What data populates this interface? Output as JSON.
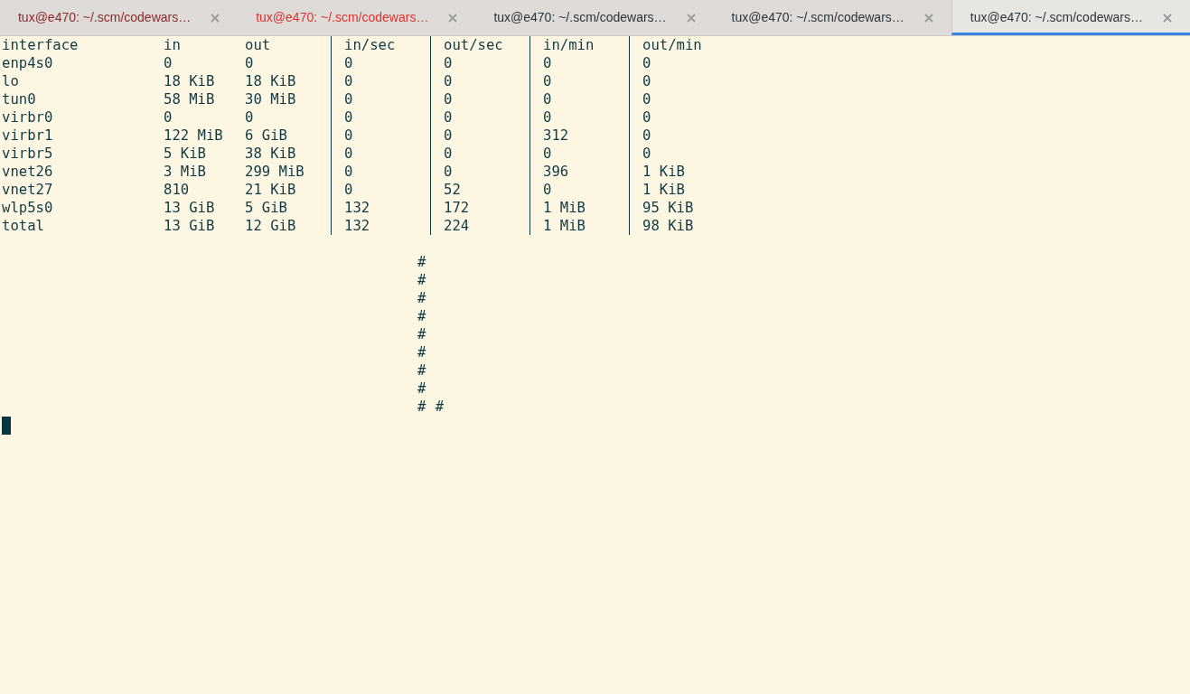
{
  "tabs": [
    {
      "title": "tux@e470: ~/.scm/codewars…",
      "color": "#8b2a2a",
      "selected": false
    },
    {
      "title": "tux@e470: ~/.scm/codewars…",
      "color": "#e0312e",
      "selected": false
    },
    {
      "title": "tux@e470: ~/.scm/codewars…",
      "color": "#2e3436",
      "selected": false
    },
    {
      "title": "tux@e470: ~/.scm/codewars…",
      "color": "#2e3436",
      "selected": false
    },
    {
      "title": "tux@e470: ~/.scm/codewars…",
      "color": "#2e3436",
      "selected": true
    }
  ],
  "table": {
    "columns": [
      "interface",
      "in",
      "out",
      "in/sec",
      "out/sec",
      "in/min",
      "out/min"
    ],
    "rows": [
      [
        "enp4s0",
        "0",
        "0",
        "0",
        "0",
        "0",
        "0"
      ],
      [
        "lo",
        "18 KiB",
        "18 KiB",
        "0",
        "0",
        "0",
        "0"
      ],
      [
        "tun0",
        "58 MiB",
        "30 MiB",
        "0",
        "0",
        "0",
        "0"
      ],
      [
        "virbr0",
        "0",
        "0",
        "0",
        "0",
        "0",
        "0"
      ],
      [
        "virbr1",
        "122 MiB",
        "6 GiB",
        "0",
        "0",
        "312",
        "0"
      ],
      [
        "virbr5",
        "5 KiB",
        "38 KiB",
        "0",
        "0",
        "0",
        "0"
      ],
      [
        "vnet26",
        "3 MiB",
        "299 MiB",
        "0",
        "0",
        "396",
        "1 KiB"
      ],
      [
        "vnet27",
        "810",
        "21 KiB",
        "0",
        "52",
        "0",
        "1 KiB"
      ],
      [
        "wlp5s0",
        "13 GiB",
        "5 GiB",
        "132",
        "172",
        "1 MiB",
        "95 KiB"
      ],
      [
        "total",
        "13 GiB",
        "12 GiB",
        "132",
        "224",
        "1 MiB",
        "98 KiB"
      ]
    ]
  },
  "graph_lines": [
    "#",
    "#",
    "#",
    "#",
    "#",
    "#",
    "#",
    "#",
    "# #"
  ]
}
